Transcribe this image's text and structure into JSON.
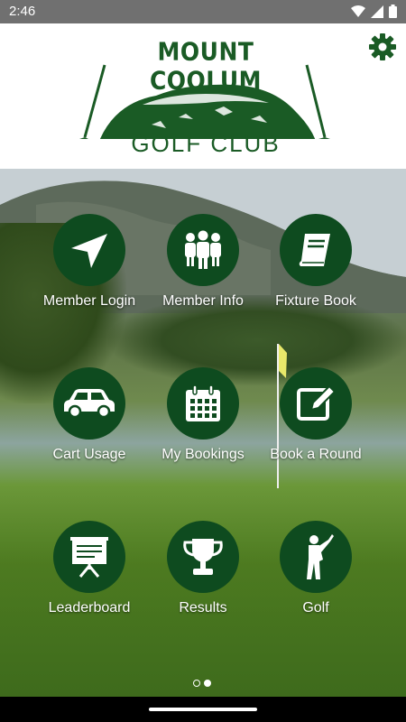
{
  "status_bar": {
    "time": "2:46",
    "icons": [
      "wifi-icon",
      "signal-icon",
      "battery-icon"
    ]
  },
  "header": {
    "logo_line1": "MOUNT COOLUM",
    "logo_line2": "GOLF CLUB",
    "settings_icon": "gear-icon",
    "brand_color": "#1a5b25"
  },
  "tiles": [
    {
      "label": "Member Login",
      "icon": "navigation-arrow-icon"
    },
    {
      "label": "Member Info",
      "icon": "people-group-icon"
    },
    {
      "label": "Fixture Book",
      "icon": "book-icon"
    },
    {
      "label": "Cart Usage",
      "icon": "car-icon"
    },
    {
      "label": "My Bookings",
      "icon": "calendar-icon"
    },
    {
      "label": "Book a Round",
      "icon": "edit-icon"
    },
    {
      "label": "Leaderboard",
      "icon": "presentation-board-icon"
    },
    {
      "label": "Results",
      "icon": "trophy-icon"
    },
    {
      "label": "Golf",
      "icon": "golfer-icon"
    }
  ],
  "pager": {
    "pages": 2,
    "current": 1
  },
  "colors": {
    "tile_circle": "#0e4b1f",
    "label_text": "#ffffff"
  }
}
